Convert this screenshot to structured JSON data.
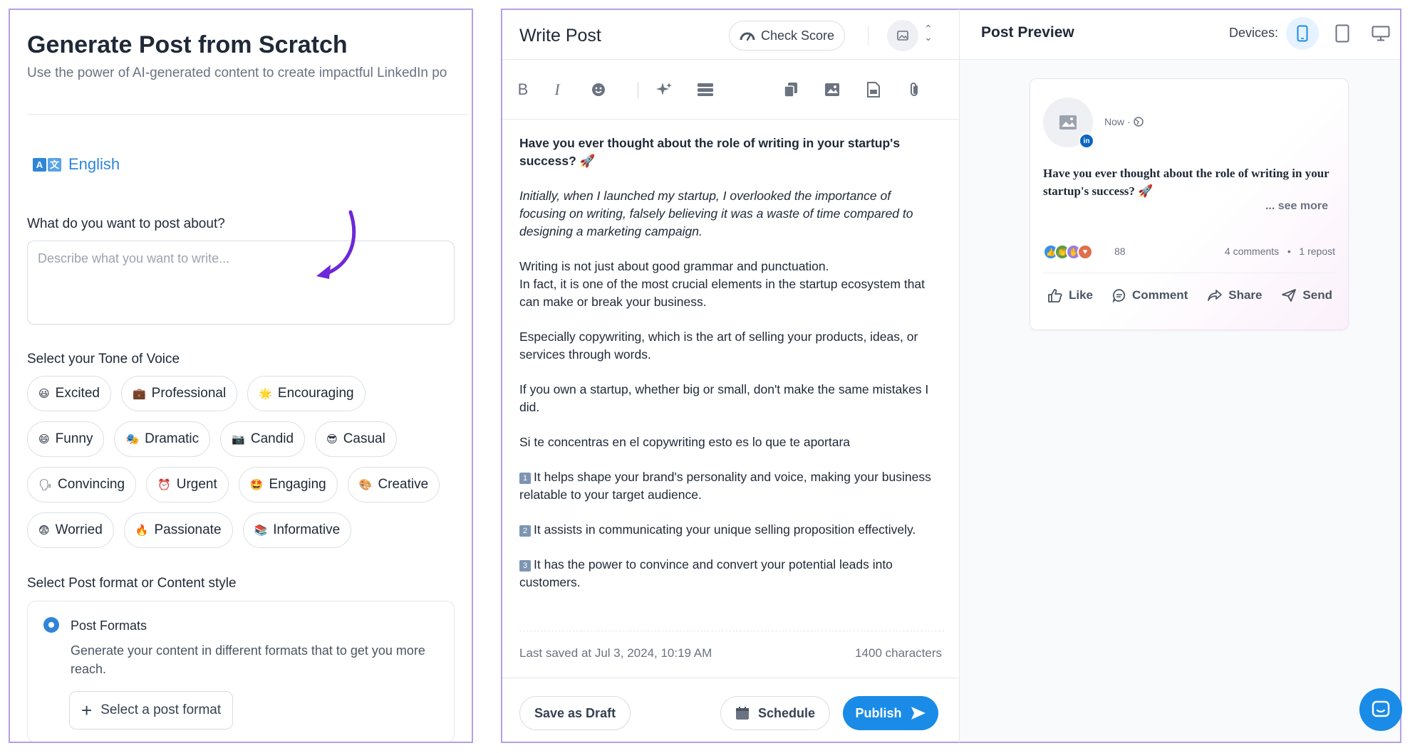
{
  "left": {
    "title": "Generate Post from Scratch",
    "subtitle": "Use the power of AI-generated content to create impactful LinkedIn po",
    "language": "English",
    "question_label": "What do you want to post about?",
    "question_placeholder": "Describe what you want to write...",
    "tone_label": "Select your Tone of Voice",
    "tones": [
      [
        {
          "emoji": "😃",
          "label": "Excited"
        },
        {
          "emoji": "💼",
          "label": "Professional"
        },
        {
          "emoji": "🌟",
          "label": "Encouraging"
        }
      ],
      [
        {
          "emoji": "😄",
          "label": "Funny"
        },
        {
          "emoji": "🎭",
          "label": "Dramatic"
        },
        {
          "emoji": "📷",
          "label": "Candid"
        },
        {
          "emoji": "😎",
          "label": "Casual"
        }
      ],
      [
        {
          "emoji": "🗣",
          "label": "Convincing"
        },
        {
          "emoji": "⏰",
          "label": "Urgent"
        },
        {
          "emoji": "🤩",
          "label": "Engaging"
        },
        {
          "emoji": "🎨",
          "label": "Creative"
        }
      ],
      [
        {
          "emoji": "😨",
          "label": "Worried"
        },
        {
          "emoji": "🔥",
          "label": "Passionate"
        },
        {
          "emoji": "📚",
          "label": "Informative"
        }
      ]
    ],
    "format_label": "Select Post format or Content style",
    "format_option_title": "Post Formats",
    "format_option_desc": "Generate your content in different formats that to get you more reach.",
    "format_button": "Select a post format"
  },
  "editor": {
    "title": "Write Post",
    "check_score": "Check Score",
    "paragraphs": [
      {
        "style": "bold",
        "text": "Have you ever thought about the role of writing in your startup's success? 🚀"
      },
      {
        "style": "italic",
        "text": "Initially, when I launched my startup, I overlooked the importance of focusing on writing, falsely believing it was a waste of time compared to designing a marketing campaign."
      },
      {
        "style": "normal",
        "lines": [
          "Writing is not just about good grammar and punctuation.",
          "In fact, it is one of the most crucial elements in the startup ecosystem that can make or break your business."
        ]
      },
      {
        "style": "normal",
        "text": "Especially copywriting, which is the art of selling your products, ideas, or services through words."
      },
      {
        "style": "normal",
        "text": "If you own a startup, whether big or small, don't make the same mistakes I did."
      },
      {
        "style": "normal",
        "text": "Si te concentras en el copywriting esto es lo que te aportara"
      },
      {
        "style": "numbered",
        "num": "1",
        "text": "It helps shape your brand's personality and voice, making your business relatable to your target audience."
      },
      {
        "style": "numbered",
        "num": "2",
        "text": "It assists in communicating your unique selling proposition effectively."
      },
      {
        "style": "numbered",
        "num": "3",
        "text": "It has the power to convince and convert your potential leads into customers."
      }
    ],
    "last_saved": "Last saved at Jul 3, 2024, 10:19 AM",
    "characters": "1400 characters",
    "save_draft": "Save as Draft",
    "schedule": "Schedule",
    "publish": "Publish"
  },
  "preview": {
    "title": "Post Preview",
    "devices_label": "Devices:",
    "time": "Now",
    "post_text": "Have you ever thought about the role of writing in your startup's success? 🚀",
    "see_more": "... see more",
    "reaction_count": "88",
    "comments": "4 comments",
    "reposts": "1 repost",
    "actions": {
      "like": "Like",
      "comment": "Comment",
      "share": "Share",
      "send": "Send"
    }
  },
  "colors": {
    "accent": "#1a8be6",
    "language_blue": "#2f86d7",
    "arrow_purple": "#6d28d9",
    "border_purple": "#b79ee6"
  }
}
